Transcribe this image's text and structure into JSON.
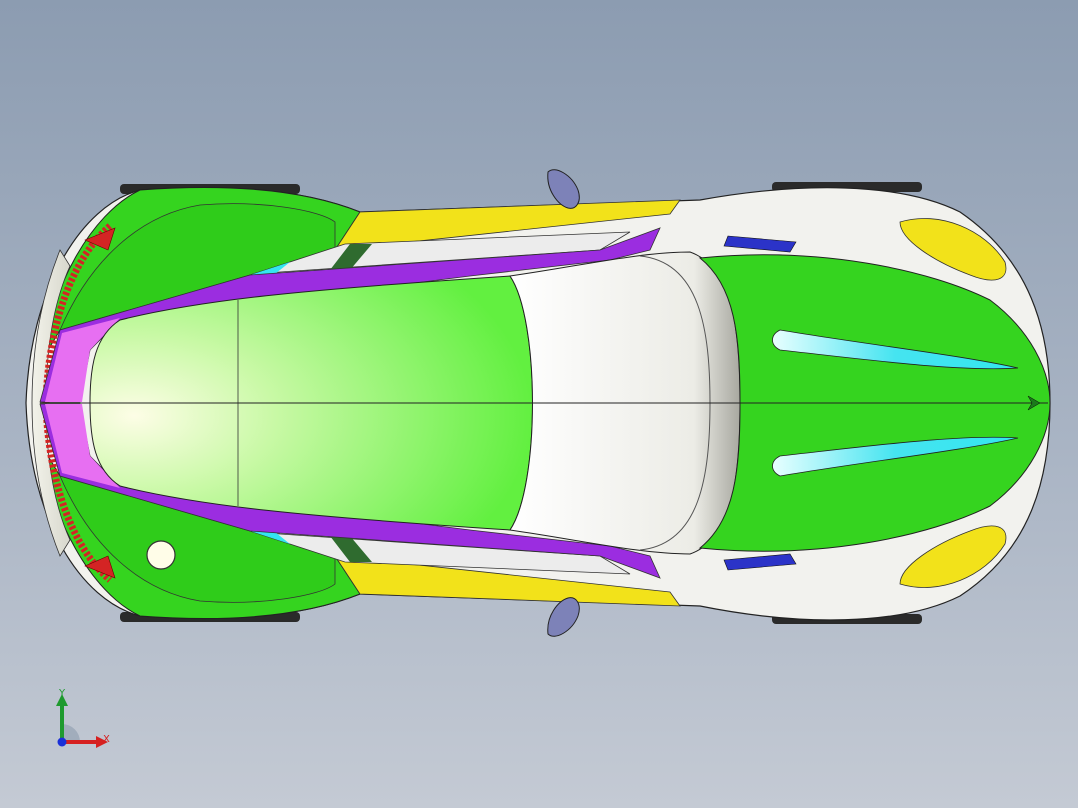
{
  "viewport": {
    "background_top": "#8c9cb1",
    "background_bottom": "#c4cad4"
  },
  "model": {
    "view": "top",
    "subject": "sports car body",
    "colors": {
      "green": "#35d41f",
      "light_green": "#7cf25a",
      "white": "#f2f2ee",
      "yellow": "#f2e21a",
      "purple": "#9b2de0",
      "magenta": "#e76ff2",
      "cyan": "#33e6f0",
      "blue": "#2b33c8",
      "red": "#d42424",
      "mirror": "#7d82b8"
    }
  },
  "triad": {
    "y_label": "Y",
    "x_label": "X",
    "y_color": "#1e9a2e",
    "x_color": "#d62020",
    "origin_color": "#1a2fd8"
  }
}
